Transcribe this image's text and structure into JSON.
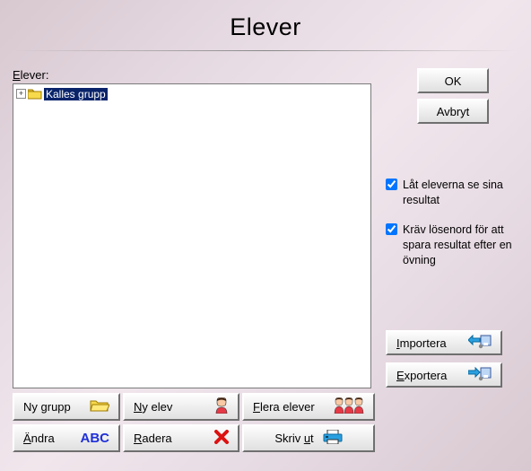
{
  "title": "Elever",
  "list_label_prefix": "E",
  "list_label_rest": "lever:",
  "tree": {
    "item0": "Kalles grupp"
  },
  "side": {
    "ok": "OK",
    "cancel": "Avbryt"
  },
  "checks": {
    "c1": "Låt eleverna se sina resultat",
    "c2": "Kräv lösenord för att spara resultat efter en övning"
  },
  "impexp": {
    "import_ul": "I",
    "import_rest": "mportera",
    "export_ul": "E",
    "export_rest": "xportera"
  },
  "bottom": {
    "newgroup_pre": "Ny ",
    "newgroup_ul": "g",
    "newgroup_post": "rupp",
    "newstudent_pre": "",
    "newstudent_ul": "N",
    "newstudent_post": "y elev",
    "many_pre": "",
    "many_ul": "F",
    "many_post": "lera elever",
    "edit_pre": "",
    "edit_ul": "Ä",
    "edit_post": "ndra",
    "del_pre": "",
    "del_ul": "R",
    "del_post": "adera",
    "print_pre": "Skriv ",
    "print_ul": "u",
    "print_post": "t"
  }
}
